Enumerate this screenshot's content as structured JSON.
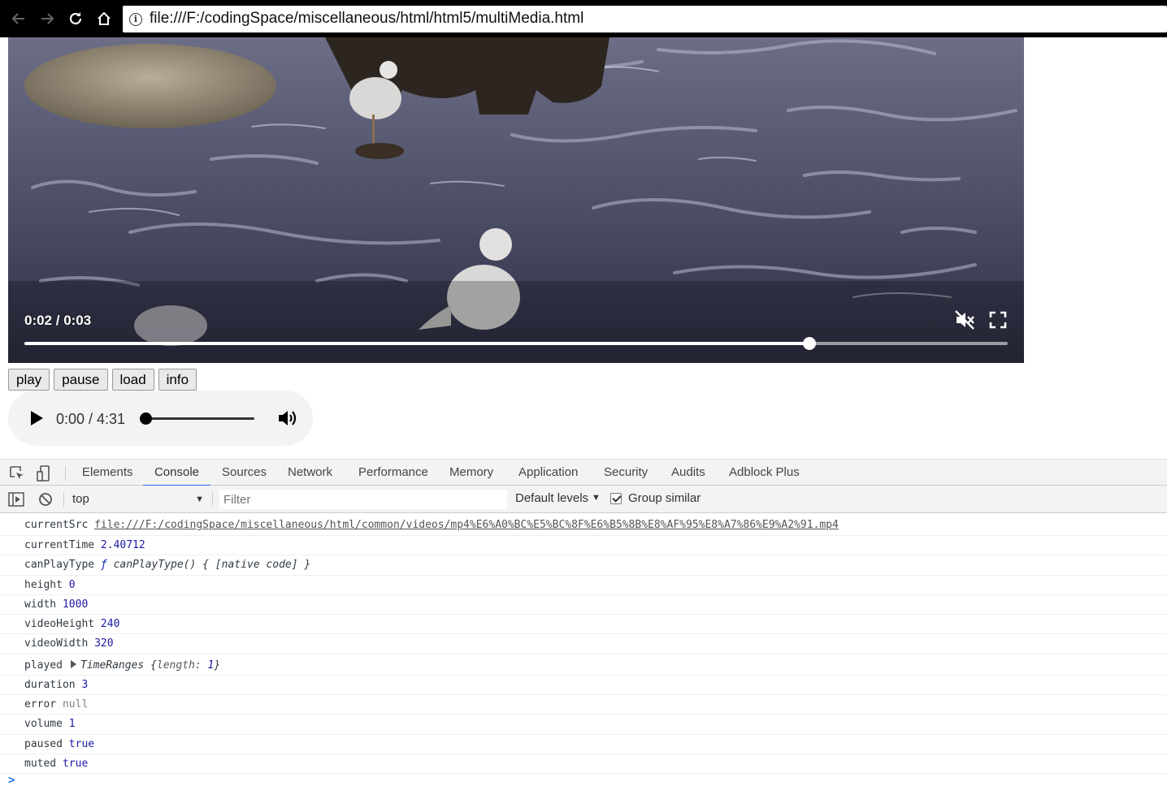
{
  "browser": {
    "url": "file:///F:/codingSpace/miscellaneous/html/html5/multiMedia.html"
  },
  "video": {
    "time_display": "0:02 / 0:03",
    "progress_fraction": 0.798,
    "muted": true
  },
  "buttons": {
    "play": "play",
    "pause": "pause",
    "load": "load",
    "info": "info"
  },
  "audio": {
    "time_display": "0:00 / 4:31",
    "progress_fraction": 0
  },
  "devtools": {
    "tabs": [
      "Elements",
      "Console",
      "Sources",
      "Network",
      "Performance",
      "Memory",
      "Application",
      "Security",
      "Audits",
      "Adblock Plus"
    ],
    "active_tab": "Console",
    "context": "top",
    "filter_placeholder": "Filter",
    "levels": "Default levels",
    "group_similar": "Group similar",
    "group_similar_checked": true
  },
  "console": {
    "currentSrc_key": "currentSrc",
    "currentSrc_val": "file:///F:/codingSpace/miscellaneous/html/common/videos/mp4%E6%A0%BC%E5%BC%8F%E6%B5%8B%E8%AF%95%E8%A7%86%E9%A2%91.mp4",
    "currentTime_key": "currentTime",
    "currentTime_val": "2.40712",
    "canPlayType_key": "canPlayType",
    "canPlayType_f": "ƒ",
    "canPlayType_val": "canPlayType() { [native code] }",
    "height_key": "height",
    "height_val": "0",
    "width_key": "width",
    "width_val": "1000",
    "videoHeight_key": "videoHeight",
    "videoHeight_val": "240",
    "videoWidth_key": "videoWidth",
    "videoWidth_val": "320",
    "played_key": "played",
    "played_type": "TimeRanges",
    "played_open": "{",
    "played_prop": "length:",
    "played_len": "1",
    "played_close": "}",
    "duration_key": "duration",
    "duration_val": "3",
    "error_key": "error",
    "error_val": "null",
    "volume_key": "volume",
    "volume_val": "1",
    "paused_key": "paused",
    "paused_val": "true",
    "muted_key": "muted",
    "muted_val": "true",
    "prompt": ">"
  }
}
